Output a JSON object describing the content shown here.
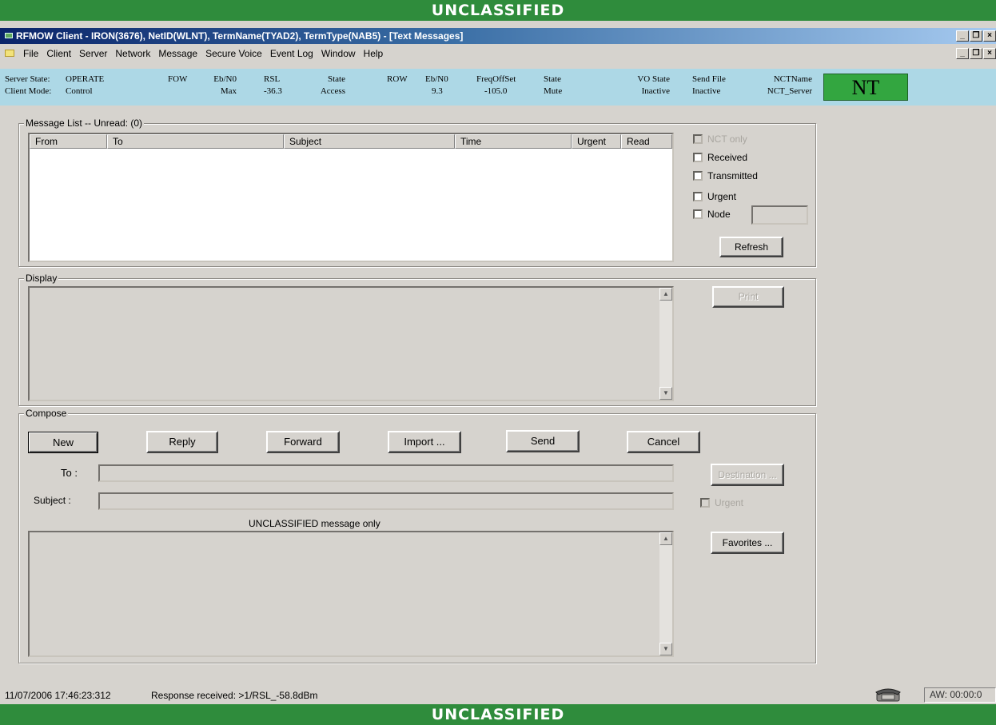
{
  "classification": {
    "top": "UNCLASSIFIED",
    "bottom": "UNCLASSIFIED"
  },
  "window": {
    "title": "RFMOW Client - IRON(3676), NetID(WLNT), TermName(TYAD2), TermType(NAB5) - [Text Messages]"
  },
  "menu": [
    "File",
    "Client",
    "Server",
    "Network",
    "Message",
    "Secure Voice",
    "Event Log",
    "Window",
    "Help"
  ],
  "status": {
    "server_state_label": "Server State:",
    "server_state": "OPERATE",
    "client_mode_label": "Client Mode:",
    "client_mode": "Control",
    "fow": "FOW",
    "ebno_label": "Eb/N0",
    "ebno_value": "Max",
    "rsl_label": "RSL",
    "rsl_value": "-36.3",
    "state1_label": "State",
    "state1_value": "Access",
    "row": "ROW",
    "ebno2_label": "Eb/N0",
    "ebno2_value": "9.3",
    "freq_label": "FreqOffSet",
    "freq_value": "-105.0",
    "state2_label": "State",
    "state2_value": "Mute",
    "vo_label": "VO State",
    "vo_value": "Inactive",
    "sendfile_label": "Send File",
    "sendfile_value": "Inactive",
    "nctname_label": "NCTName",
    "nctname_value": "NCT_Server",
    "indicator": "NT",
    "indicator_color": "#33a640"
  },
  "message_list": {
    "label": "Message List -- Unread: (0)",
    "columns": [
      "From",
      "To",
      "Subject",
      "Time",
      "Urgent",
      "Read"
    ],
    "rows": [],
    "filters": {
      "nct_only": "NCT only",
      "received": "Received",
      "transmitted": "Transmitted",
      "urgent": "Urgent",
      "node": "Node"
    },
    "refresh": "Refresh"
  },
  "display": {
    "label": "Display",
    "print": "Print"
  },
  "compose": {
    "label": "Compose",
    "buttons": {
      "new": "New",
      "reply": "Reply",
      "forward": "Forward",
      "import": "Import ...",
      "send": "Send",
      "cancel": "Cancel"
    },
    "to_label": "To :",
    "subject_label": "Subject :",
    "destination": "Destination ...",
    "urgent": "Urgent",
    "notice": "UNCLASSIFIED message only",
    "favorites": "Favorites ..."
  },
  "statusbar": {
    "timestamp": "11/07/2006 17:46:23:312",
    "message": "Response received: >1/RSL_-58.8dBm",
    "aw": "AW: 00:00:0"
  }
}
